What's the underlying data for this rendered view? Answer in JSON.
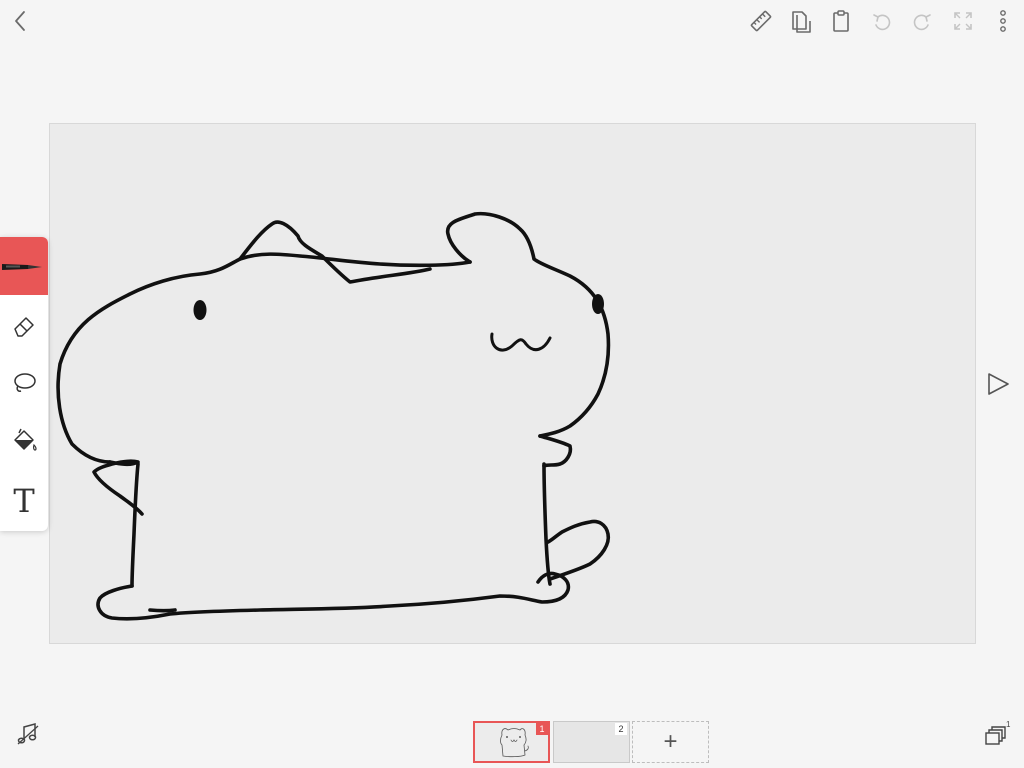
{
  "top_bar": {
    "back_icon": "chevron-left-icon",
    "ruler_icon": "ruler-icon",
    "pages_icon": "copy-pages-icon",
    "paste_icon": "clipboard-icon",
    "undo_icon": "undo-icon",
    "redo_icon": "redo-icon",
    "fit_icon": "fullscreen-icon",
    "more_icon": "more-vertical-icon"
  },
  "tools": [
    {
      "name": "pen",
      "icon": "pen-icon",
      "selected": true
    },
    {
      "name": "eraser",
      "icon": "eraser-icon",
      "selected": false
    },
    {
      "name": "lasso",
      "icon": "lasso-icon",
      "selected": false
    },
    {
      "name": "fill",
      "icon": "paint-bucket-icon",
      "selected": false
    },
    {
      "name": "text",
      "icon": "text-icon",
      "label": "T",
      "selected": false
    }
  ],
  "canvas": {
    "drawing": "cat-sketch",
    "background": "#ebebeb"
  },
  "playback": {
    "play_icon": "play-icon"
  },
  "frames": [
    {
      "number": "1",
      "selected": true
    },
    {
      "number": "2",
      "selected": false
    }
  ],
  "add_frame": {
    "label": "+"
  },
  "bottom_bar": {
    "audio_icon": "music-note-icon",
    "layers_icon": "layers-icon",
    "layers_badge": "1"
  },
  "colors": {
    "accent": "#e85656",
    "icon": "#6b6b6b",
    "icon_disabled": "#c4c4c4",
    "stroke": "#111111"
  }
}
